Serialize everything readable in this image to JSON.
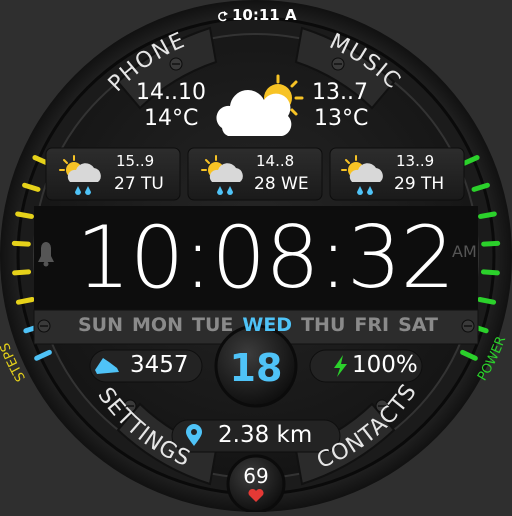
{
  "top_time": "10:11 A",
  "segments": {
    "phone": "PHONE",
    "music": "MUSIC",
    "settings": "SETTINGS",
    "contacts": "CONTACTS"
  },
  "current_weather": {
    "left_range": "14..10",
    "left_temp": "14°C",
    "right_range": "13..7",
    "right_temp": "13°C",
    "icon": "partly-cloudy-sun-icon"
  },
  "forecast": [
    {
      "range": "15..9",
      "day": "27 TU",
      "icon": "rain-sun-icon"
    },
    {
      "range": "14..8",
      "day": "28 WE",
      "icon": "rain-sun-icon"
    },
    {
      "range": "13..9",
      "day": "29 TH",
      "icon": "rain-sun-icon"
    }
  ],
  "clock": {
    "time": "10:08:32",
    "ampm": "AM"
  },
  "days": {
    "items": [
      "SUN",
      "MON",
      "TUE",
      "WED",
      "THU",
      "FRI",
      "SAT"
    ],
    "active": "WED",
    "active_color": "#4fc3f7"
  },
  "steps": {
    "value": "3457",
    "label": "STEPS"
  },
  "date_day": "18",
  "power": {
    "value": "100%",
    "label": "POWER"
  },
  "distance": "2.38 km",
  "heart_rate": "69",
  "colors": {
    "accent_blue": "#4fc3f7",
    "steps_yellow": "#e6d21a",
    "power_green": "#2bd12b"
  }
}
